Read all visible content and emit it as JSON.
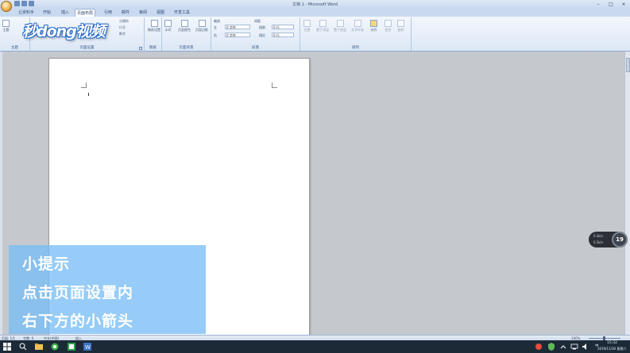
{
  "window": {
    "title": "文档 1 - Microsoft Word",
    "controls": [
      "–",
      "□",
      "×"
    ]
  },
  "tabs": [
    "让资料手",
    "开始",
    "插入",
    "页面布局",
    "引用",
    "邮件",
    "审阅",
    "视图",
    "开发工具"
  ],
  "active_tab": "页面布局",
  "ribbon": {
    "groups": {
      "themes": "主题",
      "page_setup": "页面设置",
      "draft": "稿纸",
      "page_background": "页面背景",
      "paragraph": "段落",
      "arrange": "排列"
    },
    "buttons": {
      "theme": "主题",
      "separator": "分隔符",
      "line_numbers": "行号",
      "hyphenation": "断字",
      "draft_setup": "稿纸设置",
      "watermark": "水印",
      "page_color": "页面颜色",
      "page_border": "页面边框",
      "position": "位置",
      "bring_front": "置于顶层",
      "send_back": "置于底层",
      "text_wrap": "文字环绕",
      "align": "对齐",
      "group": "组合",
      "rotate": "旋转"
    },
    "indent": {
      "label": "缩进",
      "left_label": "左",
      "left_value": "0 字符",
      "right_label": "右",
      "right_value": "0 字符"
    },
    "spacing": {
      "label": "间距",
      "before_label": "段前",
      "before_value": "0 行",
      "after_label": "段后",
      "after_value": "0 行"
    }
  },
  "watermark_logo": "秒dong视频",
  "tip": {
    "lines": [
      "小提示",
      "点击页面设置内",
      "右下方的小箭头"
    ]
  },
  "net_widget": {
    "upload": "0.3k/s",
    "download": "0.3k/s",
    "percent": "19"
  },
  "statusbar": {
    "page": "页面: 1/1",
    "words": "字数: 0",
    "language": "中文(中国)",
    "mode": "插入",
    "zoom": "100%"
  },
  "taskbar": {
    "time": "15:32",
    "date": "2019/11/30 星期六"
  },
  "colors": {
    "ribbon": "#dce7f5",
    "tip_overlay": "#78bef5",
    "taskbar": "#1c2a38"
  }
}
